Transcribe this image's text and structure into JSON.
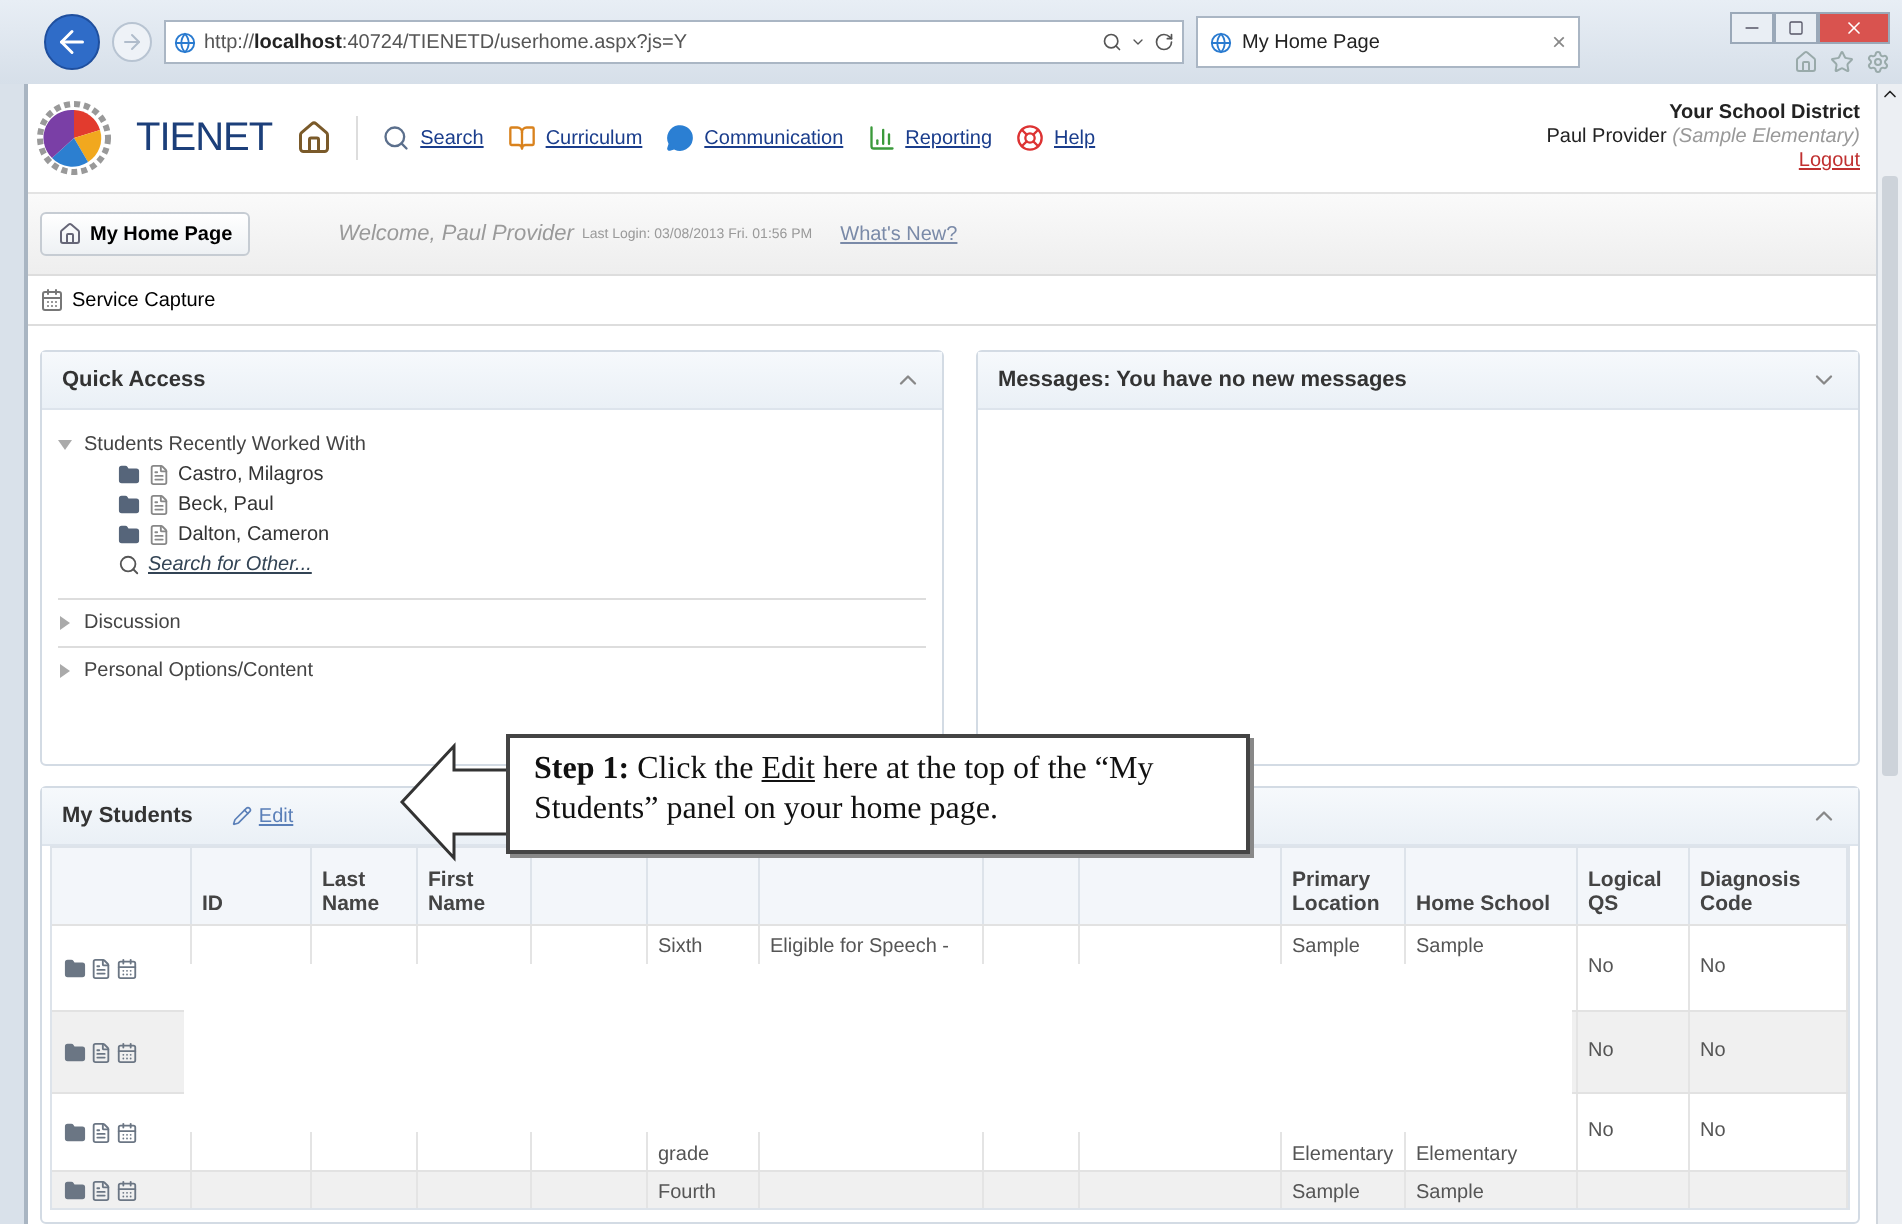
{
  "browser": {
    "address": "http://**localhost**:40724/TIENETD/userhome.aspx?js=Y",
    "tabs": [
      {
        "label": "My Home Page",
        "selected": true,
        "close": "×"
      }
    ]
  },
  "header": {
    "brand": "TIENET",
    "nav": [
      "Search",
      "Curriculum",
      "Communication",
      "Reporting",
      "Help"
    ],
    "district": "Your School District",
    "user": "Paul Provider",
    "school": "(Sample Elementary)",
    "logout": "Logout"
  },
  "subbar": {
    "home_button": "My Home Page",
    "welcome": "Welcome, Paul Provider",
    "last_login": "Last Login: 03/08/2013 Fri. 01:56 PM",
    "whats_new": "What's New?"
  },
  "toolbar": {
    "service_capture": "Service Capture"
  },
  "quick_access": {
    "title": "Quick Access",
    "expanded": true,
    "sections": [
      {
        "label": "Students Recently Worked With",
        "expanded": true,
        "children": [
          {
            "kind": "student",
            "label": "Castro, Milagros"
          },
          {
            "kind": "student",
            "label": "Beck, Paul"
          },
          {
            "kind": "student",
            "label": "Dalton, Cameron"
          },
          {
            "kind": "search",
            "label": "Search for Other..."
          }
        ]
      },
      {
        "label": "Discussion",
        "expanded": false
      },
      {
        "label": "Personal Options/Content",
        "expanded": false
      }
    ]
  },
  "messages": {
    "title": "Messages: You have no new messages",
    "expanded": false
  },
  "my_students": {
    "title": "My Students",
    "edit": "Edit",
    "expanded": true,
    "columns": [
      "ID",
      "Last Name",
      "First Name",
      null,
      null,
      null,
      null,
      null,
      "Primary Location",
      "Home School",
      "Logical QS",
      "Diagnosis Code"
    ],
    "rows": [
      {
        "cells": [
          null,
          null,
          null,
          null,
          "Sixth",
          "Eligible for Speech -",
          null,
          null,
          "Sample",
          "Sample",
          "No",
          "No"
        ]
      },
      {
        "cells": [
          null,
          null,
          null,
          null,
          null,
          null,
          null,
          null,
          null,
          null,
          "No",
          "No"
        ]
      },
      {
        "cells": [
          null,
          null,
          null,
          null,
          "grade",
          null,
          null,
          null,
          "Elementary",
          "Elementary",
          "No",
          "No"
        ]
      },
      {
        "cells": [
          null,
          null,
          null,
          null,
          "Fourth",
          null,
          null,
          null,
          "Sample",
          "Sample",
          null,
          null
        ]
      }
    ]
  },
  "callout": {
    "parts": [
      {
        "text": "**Step 1:** Click the ",
        "underline": false
      },
      {
        "text": "Edit",
        "underline": true
      },
      {
        "text": " here at the top of the “My Students” panel on your home page.",
        "underline": false
      }
    ]
  }
}
